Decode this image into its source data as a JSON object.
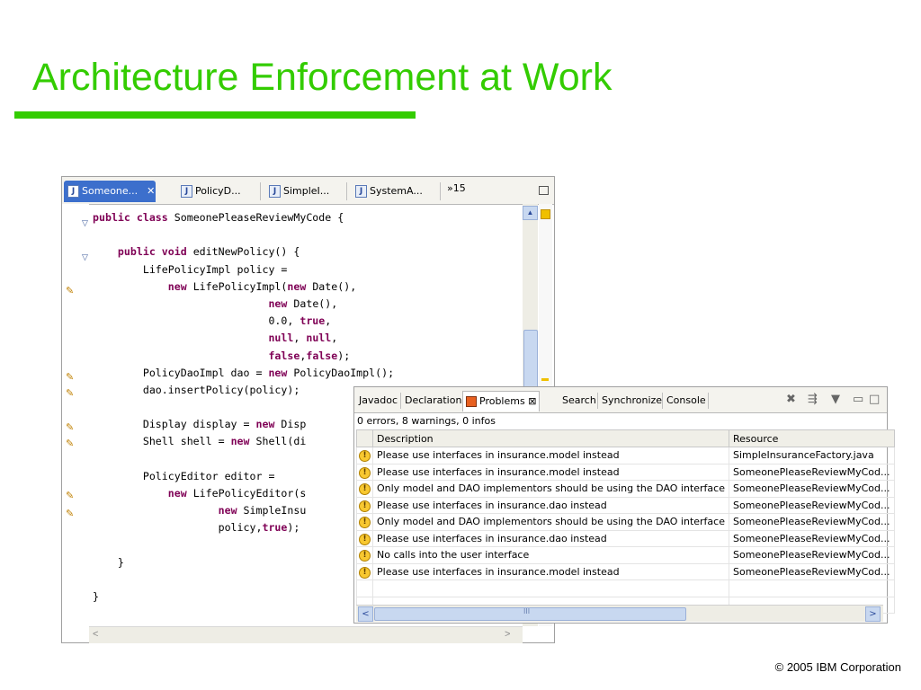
{
  "slide": {
    "title": "Architecture Enforcement at Work",
    "copyright": "© 2005 IBM Corporation"
  },
  "editor": {
    "tabs": [
      {
        "label": "Someone...",
        "active": true
      },
      {
        "label": "PolicyD..."
      },
      {
        "label": "SimpleI..."
      },
      {
        "label": "SystemA..."
      }
    ],
    "overflow_label": "»15",
    "close_glyph": "✕",
    "code_lines": [
      [
        {
          "t": "public class ",
          "k": true
        },
        {
          "t": "SomeonePleaseReviewMyCode {"
        }
      ],
      [
        {
          "t": ""
        }
      ],
      [
        {
          "t": "    "
        },
        {
          "t": "public void ",
          "k": true
        },
        {
          "t": "editNewPolicy() {"
        }
      ],
      [
        {
          "t": "        LifePolicyImpl policy ="
        }
      ],
      [
        {
          "t": "            "
        },
        {
          "t": "new ",
          "k": true
        },
        {
          "t": "LifePolicyImpl("
        },
        {
          "t": "new ",
          "k": true
        },
        {
          "t": "Date(),"
        }
      ],
      [
        {
          "t": "                            "
        },
        {
          "t": "new ",
          "k": true
        },
        {
          "t": "Date(),"
        }
      ],
      [
        {
          "t": "                            0.0, "
        },
        {
          "t": "true",
          "k": true
        },
        {
          "t": ","
        }
      ],
      [
        {
          "t": "                            "
        },
        {
          "t": "null",
          "k": true
        },
        {
          "t": ", "
        },
        {
          "t": "null",
          "k": true
        },
        {
          "t": ","
        }
      ],
      [
        {
          "t": "                            "
        },
        {
          "t": "false",
          "k": true
        },
        {
          "t": ","
        },
        {
          "t": "false",
          "k": true
        },
        {
          "t": ");"
        }
      ],
      [
        {
          "t": "        PolicyDaoImpl dao = "
        },
        {
          "t": "new ",
          "k": true
        },
        {
          "t": "PolicyDaoImpl();"
        }
      ],
      [
        {
          "t": "        dao.insertPolicy(policy);"
        }
      ],
      [
        {
          "t": ""
        }
      ],
      [
        {
          "t": "        Display display = "
        },
        {
          "t": "new ",
          "k": true
        },
        {
          "t": "Disp"
        }
      ],
      [
        {
          "t": "        Shell shell = "
        },
        {
          "t": "new ",
          "k": true
        },
        {
          "t": "Shell(di"
        }
      ],
      [
        {
          "t": ""
        }
      ],
      [
        {
          "t": "        PolicyEditor editor ="
        }
      ],
      [
        {
          "t": "            "
        },
        {
          "t": "new ",
          "k": true
        },
        {
          "t": "LifePolicyEditor(s"
        }
      ],
      [
        {
          "t": "                    "
        },
        {
          "t": "new ",
          "k": true
        },
        {
          "t": "SimpleInsu"
        }
      ],
      [
        {
          "t": "                    policy,"
        },
        {
          "t": "true",
          "k": true
        },
        {
          "t": ");"
        }
      ],
      [
        {
          "t": ""
        }
      ],
      [
        {
          "t": "    }"
        }
      ],
      [
        {
          "t": ""
        }
      ],
      [
        {
          "t": "}"
        }
      ]
    ]
  },
  "problems_view": {
    "tabs": [
      "Javadoc",
      "Declaration",
      "Problems",
      "Search",
      "Synchronize",
      "Console"
    ],
    "active_tab": "Problems",
    "summary": "0 errors, 8 warnings, 0 infos",
    "columns": {
      "description": "Description",
      "resource": "Resource"
    },
    "rows": [
      {
        "description": "Please use interfaces in insurance.model instead",
        "resource": "SimpleInsuranceFactory.java"
      },
      {
        "description": "Please use interfaces in insurance.model instead",
        "resource": "SomeonePleaseReviewMyCod..."
      },
      {
        "description": "Only model and DAO implementors should be using the DAO interface",
        "resource": "SomeonePleaseReviewMyCod..."
      },
      {
        "description": "Please use interfaces in insurance.dao instead",
        "resource": "SomeonePleaseReviewMyCod..."
      },
      {
        "description": "Only model and DAO implementors should be using the DAO interface",
        "resource": "SomeonePleaseReviewMyCod..."
      },
      {
        "description": "Please use interfaces in insurance.dao instead",
        "resource": "SomeonePleaseReviewMyCod..."
      },
      {
        "description": "No calls into the user interface",
        "resource": "SomeonePleaseReviewMyCod..."
      },
      {
        "description": "Please use interfaces in insurance.model instead",
        "resource": "SomeonePleaseReviewMyCod..."
      }
    ],
    "hscroll_grip": "III"
  },
  "colors": {
    "accent_green": "#33cc00",
    "keyword": "#7f0055",
    "active_tab_blue": "#3c6fcc"
  }
}
